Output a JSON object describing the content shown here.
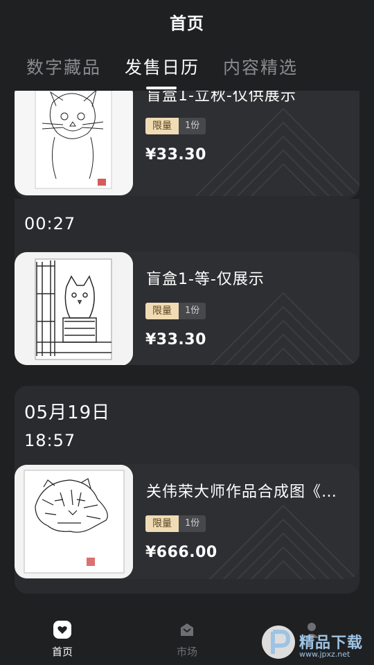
{
  "header": {
    "title": "首页"
  },
  "tabs": [
    {
      "label": "数字藏品",
      "active": false
    },
    {
      "label": "发售日历",
      "active": true
    },
    {
      "label": "内容精选",
      "active": false
    }
  ],
  "feed": {
    "groups": [
      {
        "date": "",
        "time": "",
        "items": [
          {
            "title": "盲盒1-立秋-仅供展示",
            "tag_limit": "限量",
            "tag_count": "1份",
            "price": "¥33.30",
            "image": "cat-sketch"
          }
        ]
      },
      {
        "date": "",
        "time": "00:27",
        "items": [
          {
            "title": "盲盒1-等-仅展示",
            "tag_limit": "限量",
            "tag_count": "1份",
            "price": "¥33.30",
            "image": "kitten-fence-sketch"
          }
        ]
      },
      {
        "date": "05月19日",
        "time": "18:57",
        "items": [
          {
            "title": "关伟荣大师作品合成图《威…",
            "tag_limit": "限量",
            "tag_count": "1份",
            "price": "¥666.00",
            "image": "tiger-sketch"
          }
        ]
      }
    ]
  },
  "bottom_nav": [
    {
      "label": "首页",
      "icon": "home-heart-icon",
      "active": true
    },
    {
      "label": "市场",
      "icon": "market-box-icon",
      "active": false
    },
    {
      "label": "",
      "icon": "profile-icon",
      "active": false
    }
  ],
  "watermark": {
    "text": "精品下载",
    "sub": "www.jpxz.net"
  },
  "colors": {
    "background": "#1f2022",
    "card": "#2e2f32",
    "tag_limit": "#f0dcb4",
    "tag_count": "#47484c"
  }
}
